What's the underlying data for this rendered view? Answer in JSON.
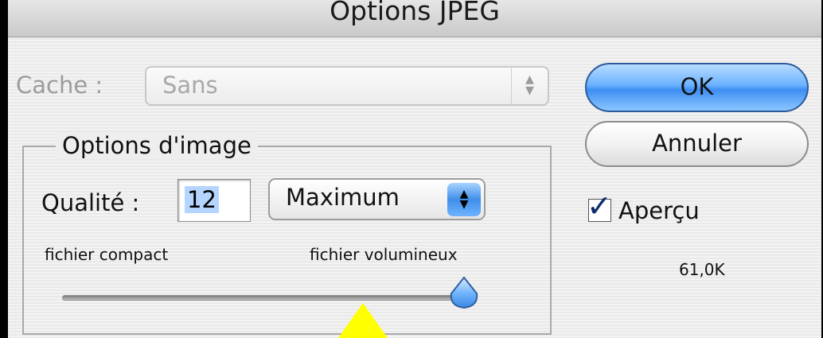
{
  "window": {
    "title": "Options JPEG"
  },
  "matte": {
    "label": "Cache :",
    "value": "Sans"
  },
  "image_options": {
    "legend": "Options d'image",
    "quality_label": "Qualité :",
    "quality_value": "12",
    "preset_value": "Maximum",
    "small_file_label": "fichier compact",
    "large_file_label": "fichier volumineux",
    "quality_slider": {
      "min": 0,
      "max": 12,
      "value": 12
    }
  },
  "buttons": {
    "ok_label": "OK",
    "cancel_label": "Annuler"
  },
  "preview": {
    "label": "Aperçu",
    "checked": true,
    "file_size": "61,0K"
  },
  "colors": {
    "default_button": "#3d8ef2",
    "pointer_arrow": "#ffff00"
  },
  "icons": {
    "select_arrows": "up-down-chevrons-icon",
    "checkmark": "checkmark-icon",
    "slider_thumb": "slider-thumb-icon",
    "pointer": "yellow-arrow-icon"
  }
}
